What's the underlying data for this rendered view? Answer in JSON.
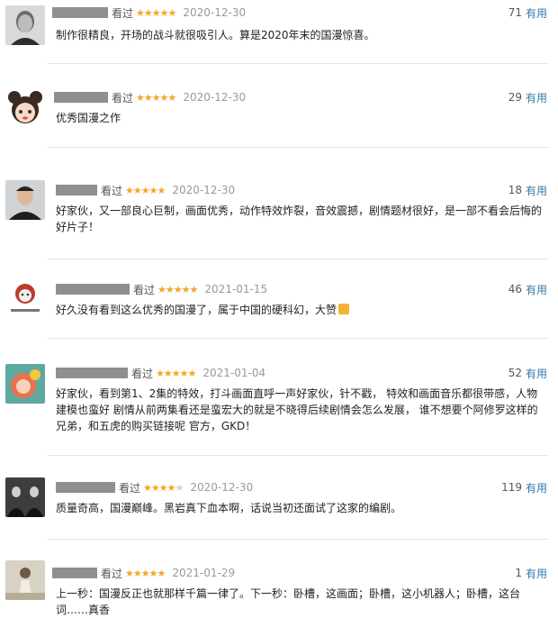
{
  "reviews": [
    {
      "watched": "看过",
      "rating": 5,
      "date": "2020-12-30",
      "useful_count": "71",
      "useful_label": "有用",
      "text": "制作很精良，开场的战斗就很吸引人。算是2020年末的国漫惊喜。"
    },
    {
      "watched": "看过",
      "rating": 5,
      "date": "2020-12-30",
      "useful_count": "29",
      "useful_label": "有用",
      "text": "优秀国漫之作"
    },
    {
      "watched": "看过",
      "rating": 5,
      "date": "2020-12-30",
      "useful_count": "18",
      "useful_label": "有用",
      "text": "好家伙，又一部良心巨制，画面优秀，动作特效炸裂，音效震撼，剧情题材很好，是一部不看会后悔的好片子！"
    },
    {
      "watched": "看过",
      "rating": 5,
      "date": "2021-01-15",
      "useful_count": "46",
      "useful_label": "有用",
      "text": "好久没有看到这么优秀的国漫了，属于中国的硬科幻，大赞"
    },
    {
      "watched": "看过",
      "rating": 5,
      "date": "2021-01-04",
      "useful_count": "52",
      "useful_label": "有用",
      "text": "好家伙，看到第1、2集的特效，打斗画面直呼一声好家伙，针不戳， 特效和画面音乐都很带感，人物建模也蛮好 剧情从前两集看还是蛮宏大的就是不晓得后续剧情会怎么发展， 谁不想要个阿修罗这样的兄弟，和五虎的购买链接呢 官方，GKD！"
    },
    {
      "watched": "看过",
      "rating": 4,
      "date": "2020-12-30",
      "useful_count": "119",
      "useful_label": "有用",
      "text": "质量奇高，国漫巅峰。黑岩真下血本啊，话说当初还面试了这家的编剧。"
    },
    {
      "watched": "看过",
      "rating": 5,
      "date": "2021-01-29",
      "useful_count": "1",
      "useful_label": "有用",
      "text": "上一秒：国漫反正也就那样千篇一律了。下一秒：卧槽，这画面；卧槽，这小机器人；卧槽，这台词……真香"
    }
  ],
  "colors": {
    "star": "#f5a623",
    "link": "#3377aa",
    "mask": "#8f8f8f"
  }
}
